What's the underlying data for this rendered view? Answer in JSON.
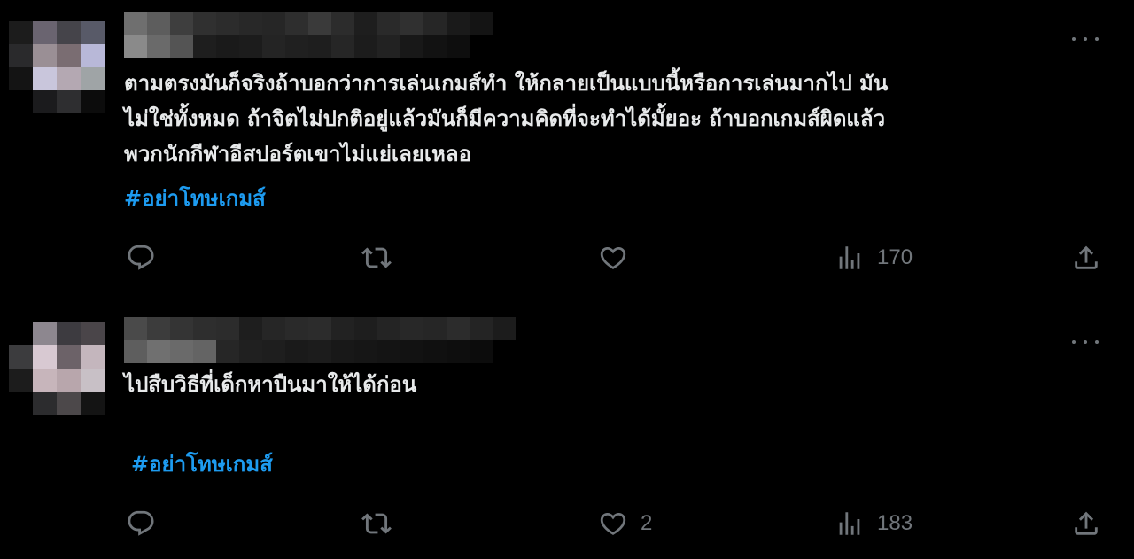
{
  "tweets": [
    {
      "lines": [
        "ตามตรงมันก็จริงถ้าบอกว่าการเล่นเกมส์ทำ ให้กลายเป็นแบบนี้หรือการเล่นมากไป มัน",
        "ไม่ใช่ทั้งหมด ถ้าจิตไม่ปกติอยู่แล้วมันก็มีความคิดที่จะทำได้มั้ยอะ ถ้าบอกเกมส์ผิดแล้ว",
        "พวกนักกีฬาอีสปอร์ตเขาไม่แย่เลยเหลอ"
      ],
      "hashtag": "#อย่าโทษเกมส์",
      "likes": "",
      "views": "170"
    },
    {
      "lines": [
        "ไปสืบวิธีที่เด็กหาปืนมาให้ได้ก่อน"
      ],
      "hashtag": "#อย่าโทษเกมส์",
      "likes": "2",
      "views": "183"
    }
  ],
  "icons": {
    "reply": "reply-icon",
    "retweet": "retweet-icon",
    "like": "heart-icon",
    "views": "views-icon",
    "share": "share-icon",
    "more": "more-icon"
  },
  "colors": {
    "background": "#000000",
    "text": "#e7e9ea",
    "hashtag": "#1d9bf0",
    "icon": "#71767b",
    "divider": "#2f3336"
  }
}
